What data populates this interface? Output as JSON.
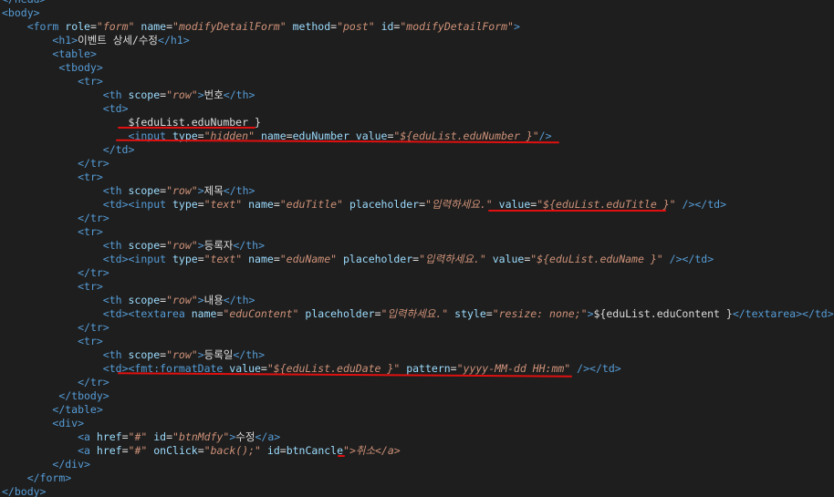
{
  "editor": {
    "lines": [
      "</head>",
      "<body>",
      "    <form role=\"form\" name=\"modifyDetailForm\" method=\"post\" id=\"modifyDetailForm\">",
      "        <h1>이벤트 상세/수정</h1>",
      "        <table>",
      "         <tbody>",
      "            <tr>",
      "                <th scope=\"row\">번호</th>",
      "                <td>",
      "                    ${eduList.eduNumber }",
      "                    <input type=\"hidden\" name=eduNumber value=\"${eduList.eduNumber }\"/>",
      "                </td>",
      "            </tr>",
      "            <tr>",
      "                <th scope=\"row\">제목</th>",
      "                <td><input type=\"text\" name=\"eduTitle\" placeholder=\"입력하세요.\" value=\"${eduList.eduTitle }\" /></td>",
      "            </tr>",
      "            <tr>",
      "                <th scope=\"row\">등록자</th>",
      "                <td><input type=\"text\" name=\"eduName\" placeholder=\"입력하세요.\" value=\"${eduList.eduName }\" /></td>",
      "            </tr>",
      "            <tr>",
      "                <th scope=\"row\">내용</th>",
      "                <td><textarea name=\"eduContent\" placeholder=\"입력하세요.\" style=\"resize: none;\">${eduList.eduContent }</textarea></td>",
      "            </tr>",
      "            <tr>",
      "                <th scope=\"row\">등록일</th>",
      "                <td><fmt:formatDate value=\"${eduList.eduDate }\" pattern=\"yyyy-MM-dd HH:mm\" /></td>",
      "            </tr>",
      "         </tbody>",
      "        </table>",
      "        <div>",
      "            <a href=\"#\" id=\"btnMdfy\">수정</a>",
      "            <a href=\"#\" onClick=\"back();\" id=btnCancle\">취소</a>",
      "        </div>",
      "    </form>",
      "</body>"
    ]
  }
}
